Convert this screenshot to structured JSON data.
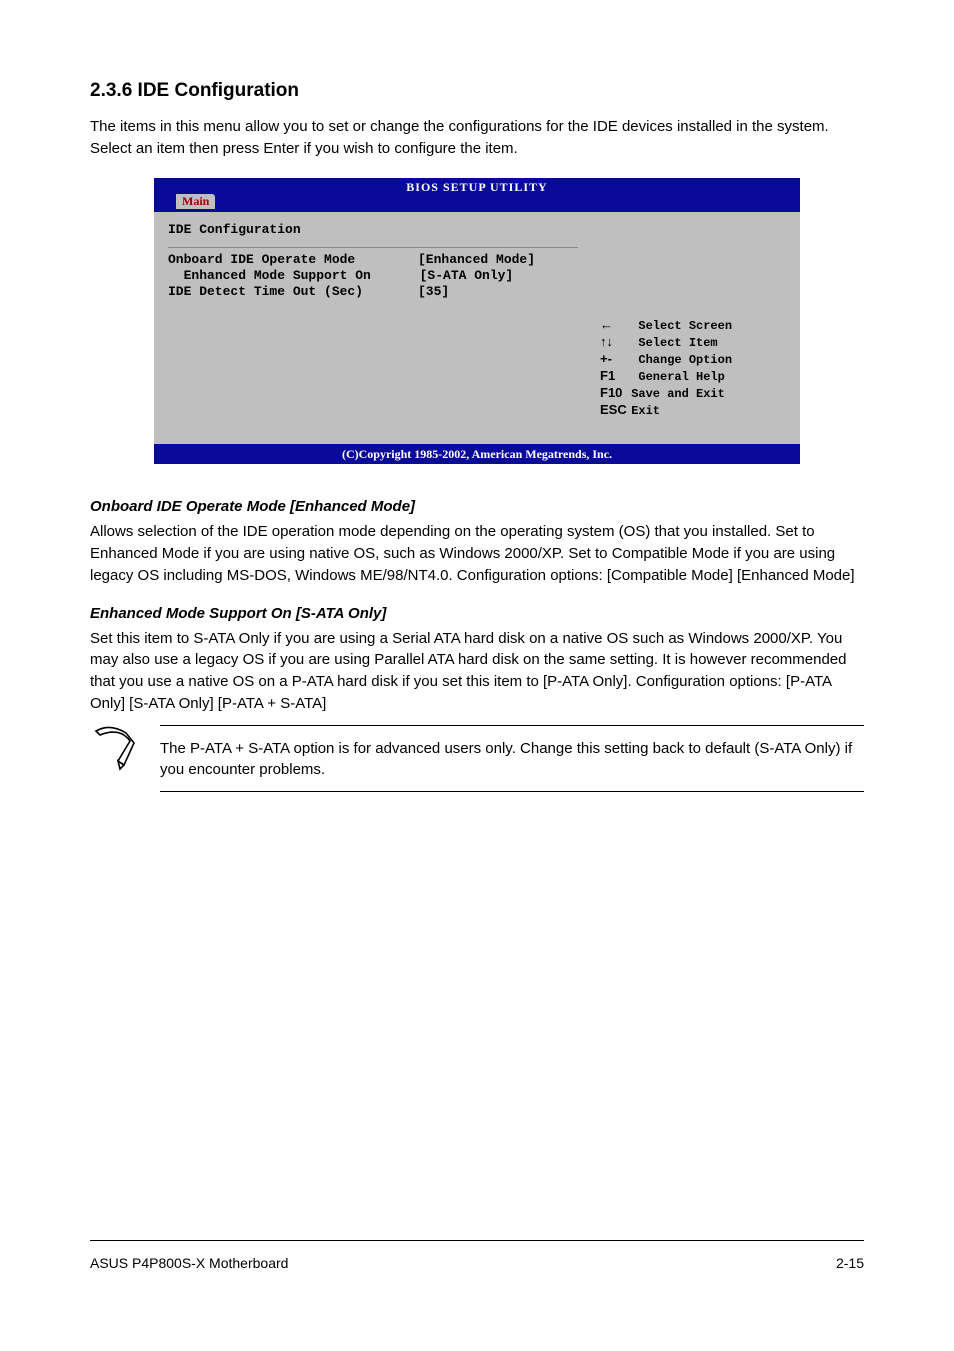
{
  "section_title": "2.3.6 IDE Configuration",
  "intro": "The items in this menu allow you to set or change the configurations for the IDE devices installed in the system. Select an item then press Enter if you wish to configure the item.",
  "bios": {
    "title": "BIOS SETUP UTILITY",
    "tab": "Main",
    "panel_title": "IDE Configuration",
    "items": [
      {
        "label": "Onboard IDE Operate Mode",
        "value": "[Enhanced Mode]",
        "indent": ""
      },
      {
        "label": "Enhanced Mode Support On",
        "value": "[S-ATA Only]",
        "indent": "  "
      },
      {
        "label": "IDE Detect Time Out (Sec)",
        "value": "[35]",
        "indent": ""
      }
    ],
    "nav": [
      {
        "key_icon": "←",
        "label": "Select Screen"
      },
      {
        "key_icon": "↑↓",
        "label": "Select Item"
      },
      {
        "key_icon": "+-",
        "label": "Change Option"
      },
      {
        "key_icon": "F1",
        "label": "General Help"
      },
      {
        "key_icon": "F10",
        "label": "Save and Exit"
      },
      {
        "key_icon": "ESC",
        "label": "Exit"
      }
    ],
    "footer": "(C)Copyright 1985-2002, American Megatrends, Inc."
  },
  "sub1": {
    "heading": "Onboard IDE Operate Mode [Enhanced Mode]",
    "text": "Allows selection of the IDE operation mode depending on the operating system (OS) that you installed. Set to Enhanced Mode if you are using native OS, such as Windows 2000/XP. Set to Compatible Mode if you are using legacy OS including MS-DOS, Windows ME/98/NT4.0. Configuration options: [Compatible Mode] [Enhanced Mode]"
  },
  "sub2": {
    "heading": "Enhanced Mode Support On [S-ATA Only]",
    "text": "Set this item to S-ATA Only if you are using a Serial ATA hard disk on a native OS such as Windows 2000/XP. You may also use a legacy OS if you are using Parallel ATA hard disk on the same setting. It is however recommended that you use a native OS on a P-ATA hard disk if you set this item to [P-ATA Only]. Configuration options: [P-ATA Only] [S-ATA Only] [P-ATA + S-ATA]"
  },
  "note": "The P-ATA + S-ATA option is for advanced users only. Change this setting back to default (S-ATA Only) if you encounter problems.",
  "footer": {
    "left": "ASUS P4P800S-X Motherboard",
    "right": "2-15"
  }
}
